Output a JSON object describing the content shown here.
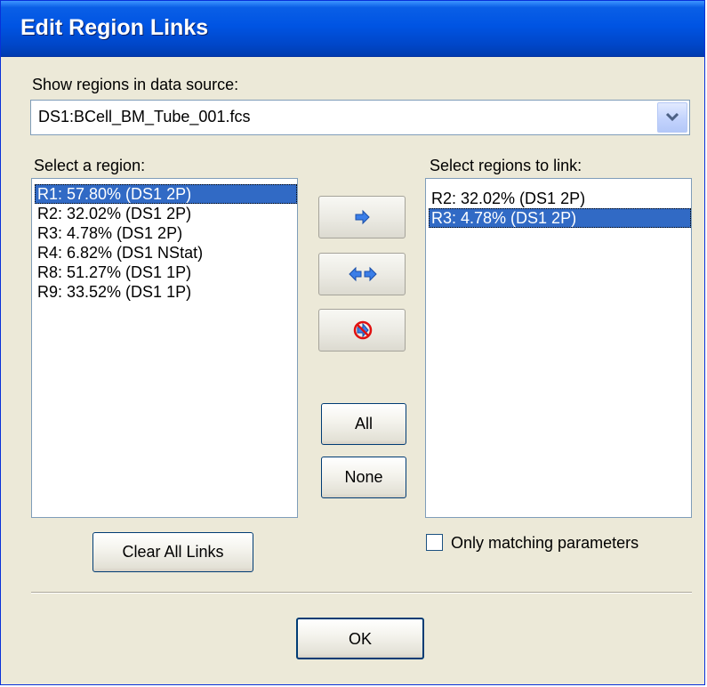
{
  "window": {
    "title": "Edit Region Links"
  },
  "data_source": {
    "label": "Show regions in data source:",
    "value": "DS1:BCell_BM_Tube_001.fcs"
  },
  "left_list": {
    "label": "Select a region:",
    "items": [
      {
        "text": "R1: 57.80% (DS1 2P)",
        "selected": true
      },
      {
        "text": "R2: 32.02% (DS1 2P)",
        "selected": false
      },
      {
        "text": "R3: 4.78% (DS1 2P)",
        "selected": false
      },
      {
        "text": "R4: 6.82% (DS1 NStat)",
        "selected": false
      },
      {
        "text": "R8: 51.27% (DS1 1P)",
        "selected": false
      },
      {
        "text": "R9: 33.52% (DS1 1P)",
        "selected": false
      }
    ]
  },
  "right_list": {
    "label": "Select regions to link:",
    "items": [
      {
        "text": "R2: 32.02% (DS1 2P)",
        "selected": false
      },
      {
        "text": "R3: 4.78% (DS1 2P)",
        "selected": true
      }
    ]
  },
  "buttons": {
    "all_label": "All",
    "none_label": "None",
    "clear_all_label": "Clear All Links",
    "ok_label": "OK",
    "link_icon": "right-arrow-icon",
    "bidirectional_icon": "bidirectional-arrows-icon",
    "unlink_icon": "no-link-icon"
  },
  "options": {
    "only_matching_label": "Only matching parameters",
    "only_matching_checked": false
  },
  "colors": {
    "title_bar": "#0054e3",
    "selection": "#316ac5",
    "dialog_bg": "#ece9d8",
    "arrow_blue": "#3a7ee8",
    "no_symbol_red": "#e01010"
  }
}
